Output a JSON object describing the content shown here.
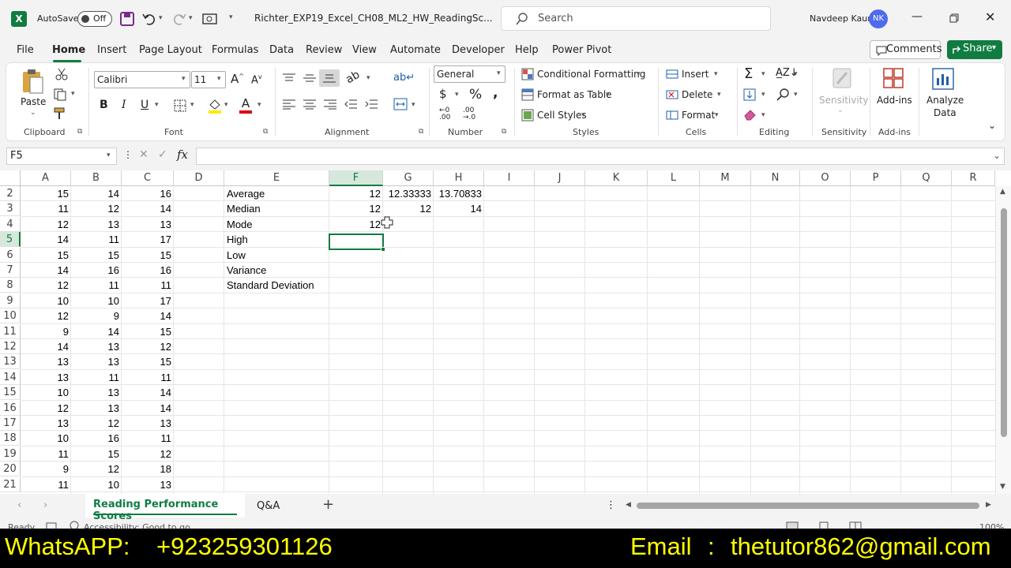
{
  "title_bar": {
    "autosave_label": "AutoSave",
    "autosave_state": "Off",
    "file_name": "Richter_EXP19_Excel_CH08_ML2_HW_ReadingSc...",
    "search_placeholder": "Search",
    "user_name": "Navdeep Kaur",
    "user_initials": "NK"
  },
  "menu_tabs": [
    "File",
    "Home",
    "Insert",
    "Page Layout",
    "Formulas",
    "Data",
    "Review",
    "View",
    "Automate",
    "Developer",
    "Help",
    "Power Pivot"
  ],
  "comments_label": "Comments",
  "share_label": "Share",
  "ribbon": {
    "clipboard": {
      "paste": "Paste",
      "group": "Clipboard"
    },
    "font": {
      "name": "Calibri",
      "size": "11",
      "group": "Font"
    },
    "alignment": {
      "group": "Alignment"
    },
    "number": {
      "format": "General",
      "group": "Number"
    },
    "styles": {
      "conditional": "Conditional Formatting",
      "format_table": "Format as Table",
      "cell_styles": "Cell Styles",
      "group": "Styles"
    },
    "cells": {
      "insert": "Insert",
      "delete": "Delete",
      "format": "Format",
      "group": "Cells"
    },
    "editing": {
      "group": "Editing"
    },
    "sensitivity": {
      "label": "Sensitivity",
      "group": "Sensitivity"
    },
    "addins": {
      "label": "Add-ins",
      "group": "Add-ins"
    },
    "analyze": {
      "label1": "Analyze",
      "label2": "Data"
    }
  },
  "formula_bar": {
    "name_box": "F5",
    "formula": ""
  },
  "columns": [
    "A",
    "B",
    "C",
    "D",
    "E",
    "F",
    "G",
    "H",
    "I",
    "J",
    "K",
    "L",
    "M",
    "N",
    "O",
    "P",
    "Q",
    "R"
  ],
  "rows": [
    "2",
    "3",
    "4",
    "5",
    "6",
    "7",
    "8",
    "9",
    "10",
    "11",
    "12",
    "13",
    "14",
    "15",
    "16",
    "17",
    "18",
    "19",
    "20",
    "21"
  ],
  "data_abc": [
    [
      "15",
      "14",
      "16"
    ],
    [
      "11",
      "12",
      "14"
    ],
    [
      "12",
      "13",
      "13"
    ],
    [
      "14",
      "11",
      "17"
    ],
    [
      "15",
      "15",
      "15"
    ],
    [
      "14",
      "16",
      "16"
    ],
    [
      "12",
      "11",
      "11"
    ],
    [
      "10",
      "10",
      "17"
    ],
    [
      "12",
      "9",
      "14"
    ],
    [
      "9",
      "14",
      "15"
    ],
    [
      "14",
      "13",
      "12"
    ],
    [
      "13",
      "13",
      "15"
    ],
    [
      "13",
      "11",
      "11"
    ],
    [
      "10",
      "13",
      "14"
    ],
    [
      "12",
      "13",
      "14"
    ],
    [
      "13",
      "12",
      "13"
    ],
    [
      "10",
      "16",
      "11"
    ],
    [
      "11",
      "15",
      "12"
    ],
    [
      "9",
      "12",
      "18"
    ],
    [
      "11",
      "10",
      "13"
    ]
  ],
  "stats_labels": [
    "Average",
    "Median",
    "Mode",
    "High",
    "Low",
    "Variance",
    "Standard Deviation"
  ],
  "stats_values": [
    [
      "12",
      "12.33333",
      "13.70833"
    ],
    [
      "12",
      "12",
      "14"
    ],
    [
      "12",
      "",
      ""
    ]
  ],
  "sheet_tabs": [
    "Reading Performance Scores",
    "Q&A"
  ],
  "status": {
    "ready": "Ready",
    "accessibility": "Accessibility: Good to go",
    "zoom": "100%"
  },
  "banner": {
    "whatsapp_label": "WhatsAPP:",
    "whatsapp_number": "+923259301126",
    "email_label": "Email",
    "email_sep": ":",
    "email": "thetutor862@gmail.com"
  },
  "colors": {
    "excel_green": "#107c41",
    "accent": "#217346",
    "banner_text": "#ffff00",
    "avatar": "#4f6bed"
  }
}
